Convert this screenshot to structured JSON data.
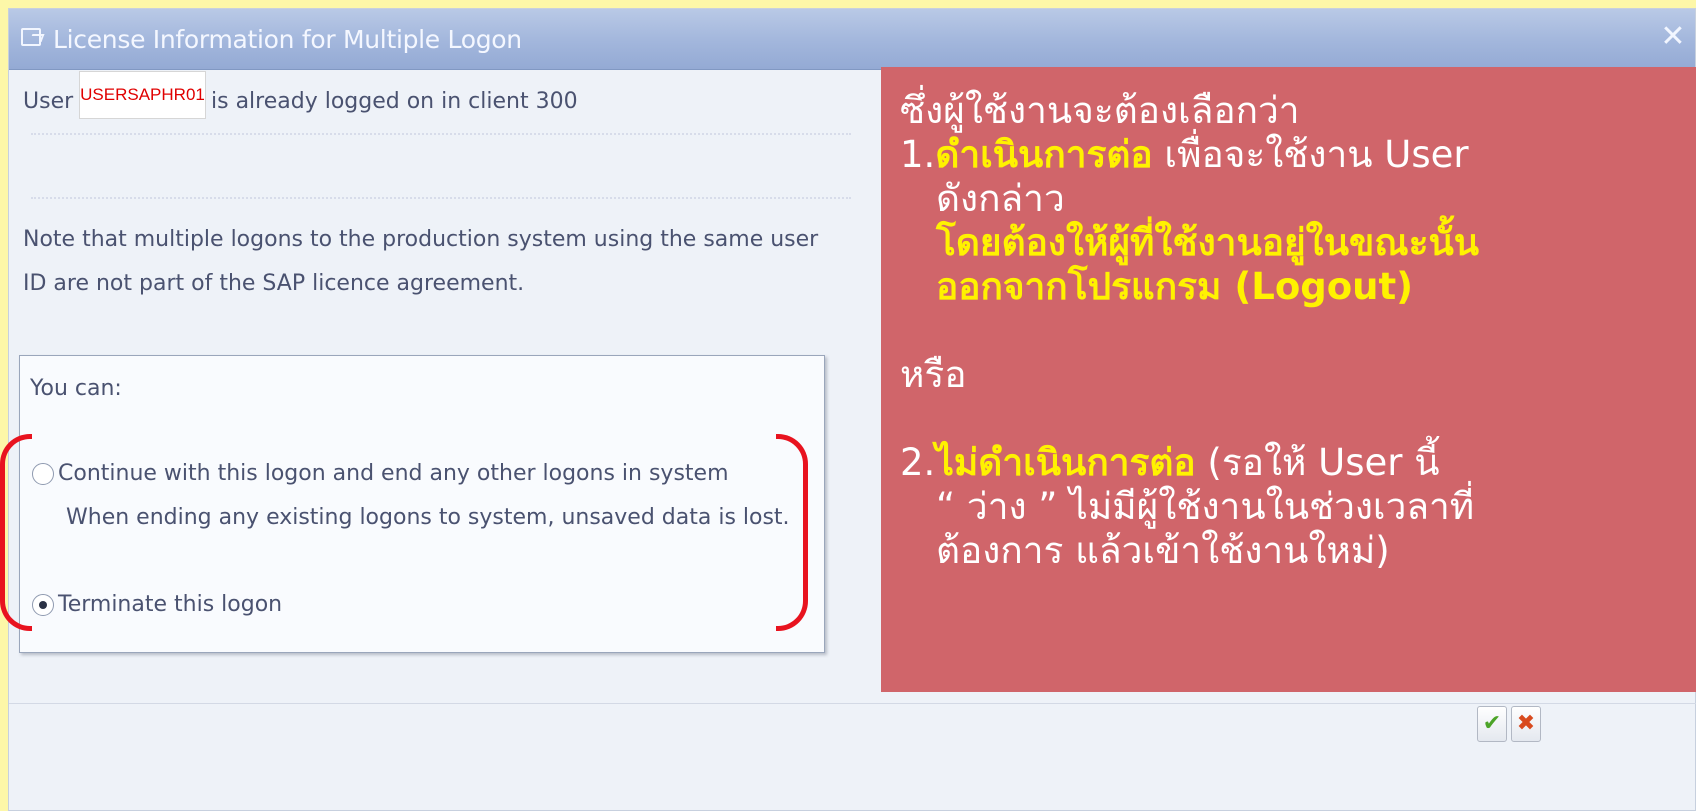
{
  "dialog": {
    "title": "License Information for Multiple Logon",
    "close_glyph": "✕",
    "user_prefix": "User",
    "username": "USERSAPHR01",
    "user_suffix": "is already logged on in client 300",
    "note_line1": "Note that multiple logons to the production system using the same user",
    "note_line2": "ID are not part of the SAP licence agreement.",
    "options_heading": "You can:",
    "option_continue_label": "Continue with this logon and end any other logons in system",
    "option_continue_hint": "When ending any existing logons to system, unsaved data is lost.",
    "option_terminate_label": "Terminate this logon",
    "selected_option": "terminate",
    "ok_icon": "✔",
    "cancel_icon": "✖",
    "icons": {
      "title": "window-icon",
      "close": "close-icon",
      "ok": "checkmark-icon",
      "cancel": "cancel-icon"
    }
  },
  "annotation": {
    "line1": "ซึ่งผู้ใช้งานจะต้องเลือกว่า",
    "item1_number": "1.",
    "item1_bold": "ดำเนินการต่อ",
    "item1_rest": "เพื่อจะใช้งาน User",
    "item1_rest2": "ดังกล่าว",
    "item1_note1": "โดยต้องให้ผู้ที่ใช้งานอยู่ในขณะนั้น",
    "item1_note2": "ออกจากโปรแกรม (Logout)",
    "or": "หรือ",
    "item2_number": "2.",
    "item2_bold": "ไม่ดำเนินการต่อ",
    "item2_rest": "(รอให้ User นี้",
    "item2_rest2": "“ ว่าง ”  ไม่มีผู้ใช้งานในช่วงเวลาที่",
    "item2_rest3": "ต้องการ แล้วเข้าใช้งานใหม่)"
  },
  "colors": {
    "highlight_bracket": "#e8131f",
    "overlay_background": "#d0656a",
    "overlay_emphasis": "#fff200",
    "username_text": "#e00000"
  }
}
